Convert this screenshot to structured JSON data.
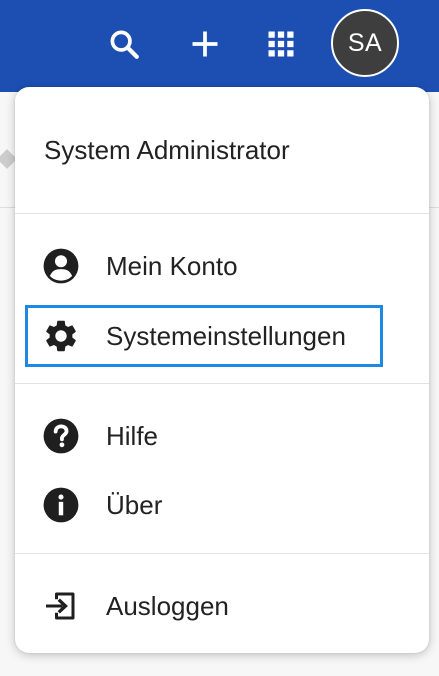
{
  "topbar": {
    "color": "#1d4fb3",
    "icons": [
      "search-icon",
      "plus-icon",
      "apps-grid-icon"
    ],
    "avatar_initials": "SA"
  },
  "menu": {
    "user_name": "System Administrator",
    "items": [
      {
        "label": "Mein Konto",
        "icon": "account-circle-icon"
      },
      {
        "label": "Systemeinstellungen",
        "icon": "gear-icon",
        "focused": true
      },
      {
        "label": "Hilfe",
        "icon": "help-circle-icon"
      },
      {
        "label": "Über",
        "icon": "info-circle-icon"
      },
      {
        "label": "Ausloggen",
        "icon": "logout-icon"
      }
    ],
    "focus_color": "#1e88e5"
  }
}
